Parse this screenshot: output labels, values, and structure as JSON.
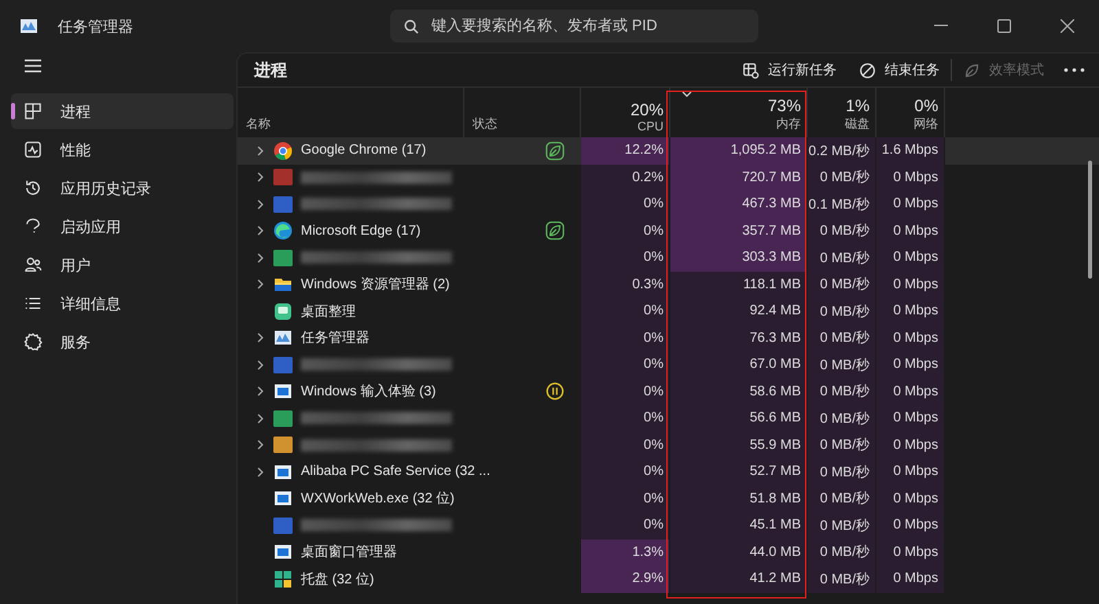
{
  "window": {
    "title": "任务管理器"
  },
  "search": {
    "placeholder": "键入要搜索的名称、发布者或 PID"
  },
  "sidebar": {
    "items": [
      {
        "label": "进程",
        "selected": true
      },
      {
        "label": "性能",
        "selected": false
      },
      {
        "label": "应用历史记录",
        "selected": false
      },
      {
        "label": "启动应用",
        "selected": false
      },
      {
        "label": "用户",
        "selected": false
      },
      {
        "label": "详细信息",
        "selected": false
      },
      {
        "label": "服务",
        "selected": false
      }
    ]
  },
  "page_title": "进程",
  "toolbar": [
    {
      "label": "运行新任务",
      "disabled": false
    },
    {
      "label": "结束任务",
      "disabled": false
    },
    {
      "label": "效率模式",
      "disabled": true
    }
  ],
  "columns": [
    {
      "label": "名称",
      "kind": "name",
      "sorted": false,
      "outlined": false
    },
    {
      "label": "状态",
      "kind": "status",
      "sorted": false,
      "outlined": false
    },
    {
      "label": "CPU",
      "percent": "20%",
      "kind": "metric",
      "sorted": false,
      "outlined": false
    },
    {
      "label": "内存",
      "percent": "73%",
      "kind": "metric",
      "sorted": true,
      "outlined": true
    },
    {
      "label": "磁盘",
      "percent": "1%",
      "kind": "metric",
      "sorted": false,
      "outlined": false
    },
    {
      "label": "网络",
      "percent": "0%",
      "kind": "metric",
      "sorted": false,
      "outlined": false
    }
  ],
  "rows": [
    {
      "name": "Google Chrome (17)",
      "expandable": true,
      "efficiency_mode": true,
      "paused": false,
      "selected": true,
      "cpu": {
        "value": "12.2%",
        "highlighted": true
      },
      "memory": {
        "value": "1,095.2 MB",
        "highlighted": true
      },
      "disk": "0.2 MB/秒",
      "network": "1.6 Mbps"
    },
    {
      "expandable": true,
      "efficiency_mode": false,
      "paused": false,
      "selected": false,
      "cpu": {
        "value": "0.2%",
        "highlighted": false
      },
      "memory": {
        "value": "720.7 MB",
        "highlighted": true
      },
      "disk": "0 MB/秒",
      "network": "0 Mbps"
    },
    {
      "expandable": true,
      "efficiency_mode": false,
      "paused": false,
      "selected": false,
      "cpu": {
        "value": "0%",
        "highlighted": false
      },
      "memory": {
        "value": "467.3 MB",
        "highlighted": true
      },
      "disk": "0.1 MB/秒",
      "network": "0 Mbps"
    },
    {
      "name": "Microsoft Edge (17)",
      "expandable": true,
      "efficiency_mode": true,
      "paused": false,
      "selected": false,
      "cpu": {
        "value": "0%",
        "highlighted": false
      },
      "memory": {
        "value": "357.7 MB",
        "highlighted": true
      },
      "disk": "0 MB/秒",
      "network": "0 Mbps"
    },
    {
      "expandable": true,
      "efficiency_mode": false,
      "paused": false,
      "selected": false,
      "cpu": {
        "value": "0%",
        "highlighted": false
      },
      "memory": {
        "value": "303.3 MB",
        "highlighted": true
      },
      "disk": "0 MB/秒",
      "network": "0 Mbps"
    },
    {
      "name": "Windows 资源管理器 (2)",
      "expandable": true,
      "efficiency_mode": false,
      "paused": false,
      "selected": false,
      "cpu": {
        "value": "0.3%",
        "highlighted": false
      },
      "memory": {
        "value": "118.1 MB",
        "highlighted": false
      },
      "disk": "0 MB/秒",
      "network": "0 Mbps"
    },
    {
      "name": "桌面整理",
      "expandable": false,
      "efficiency_mode": false,
      "paused": false,
      "selected": false,
      "cpu": {
        "value": "0%",
        "highlighted": false
      },
      "memory": {
        "value": "92.4 MB",
        "highlighted": false
      },
      "disk": "0 MB/秒",
      "network": "0 Mbps"
    },
    {
      "name": "任务管理器",
      "expandable": true,
      "efficiency_mode": false,
      "paused": false,
      "selected": false,
      "cpu": {
        "value": "0%",
        "highlighted": false
      },
      "memory": {
        "value": "76.3 MB",
        "highlighted": false
      },
      "disk": "0 MB/秒",
      "network": "0 Mbps"
    },
    {
      "expandable": true,
      "efficiency_mode": false,
      "paused": false,
      "selected": false,
      "cpu": {
        "value": "0%",
        "highlighted": false
      },
      "memory": {
        "value": "67.0 MB",
        "highlighted": false
      },
      "disk": "0 MB/秒",
      "network": "0 Mbps"
    },
    {
      "name": "Windows 输入体验 (3)",
      "expandable": true,
      "efficiency_mode": false,
      "paused": true,
      "selected": false,
      "cpu": {
        "value": "0%",
        "highlighted": false
      },
      "memory": {
        "value": "58.6 MB",
        "highlighted": false
      },
      "disk": "0 MB/秒",
      "network": "0 Mbps"
    },
    {
      "expandable": true,
      "efficiency_mode": false,
      "paused": false,
      "selected": false,
      "cpu": {
        "value": "0%",
        "highlighted": false
      },
      "memory": {
        "value": "56.6 MB",
        "highlighted": false
      },
      "disk": "0 MB/秒",
      "network": "0 Mbps"
    },
    {
      "expandable": true,
      "efficiency_mode": false,
      "paused": false,
      "selected": false,
      "cpu": {
        "value": "0%",
        "highlighted": false
      },
      "memory": {
        "value": "55.9 MB",
        "highlighted": false
      },
      "disk": "0 MB/秒",
      "network": "0 Mbps"
    },
    {
      "name": "Alibaba PC Safe Service (32 ...",
      "expandable": true,
      "efficiency_mode": false,
      "paused": false,
      "selected": false,
      "cpu": {
        "value": "0%",
        "highlighted": false
      },
      "memory": {
        "value": "52.7 MB",
        "highlighted": false
      },
      "disk": "0 MB/秒",
      "network": "0 Mbps"
    },
    {
      "name": "WXWorkWeb.exe (32 位)",
      "expandable": false,
      "efficiency_mode": false,
      "paused": false,
      "selected": false,
      "cpu": {
        "value": "0%",
        "highlighted": false
      },
      "memory": {
        "value": "51.8 MB",
        "highlighted": false
      },
      "disk": "0 MB/秒",
      "network": "0 Mbps"
    },
    {
      "expandable": false,
      "efficiency_mode": false,
      "paused": false,
      "selected": false,
      "cpu": {
        "value": "0%",
        "highlighted": false
      },
      "memory": {
        "value": "45.1 MB",
        "highlighted": false
      },
      "disk": "0 MB/秒",
      "network": "0 Mbps"
    },
    {
      "name": "桌面窗口管理器",
      "expandable": false,
      "efficiency_mode": false,
      "paused": false,
      "selected": false,
      "cpu": {
        "value": "1.3%",
        "highlighted": true
      },
      "memory": {
        "value": "44.0 MB",
        "highlighted": false
      },
      "disk": "0 MB/秒",
      "network": "0 Mbps"
    },
    {
      "name": "托盘 (32 位)",
      "expandable": false,
      "efficiency_mode": false,
      "paused": false,
      "selected": false,
      "cpu": {
        "value": "2.9%",
        "highlighted": true
      },
      "memory": {
        "value": "41.2 MB",
        "highlighted": false
      },
      "disk": "0 MB/秒",
      "network": "0 Mbps"
    }
  ]
}
